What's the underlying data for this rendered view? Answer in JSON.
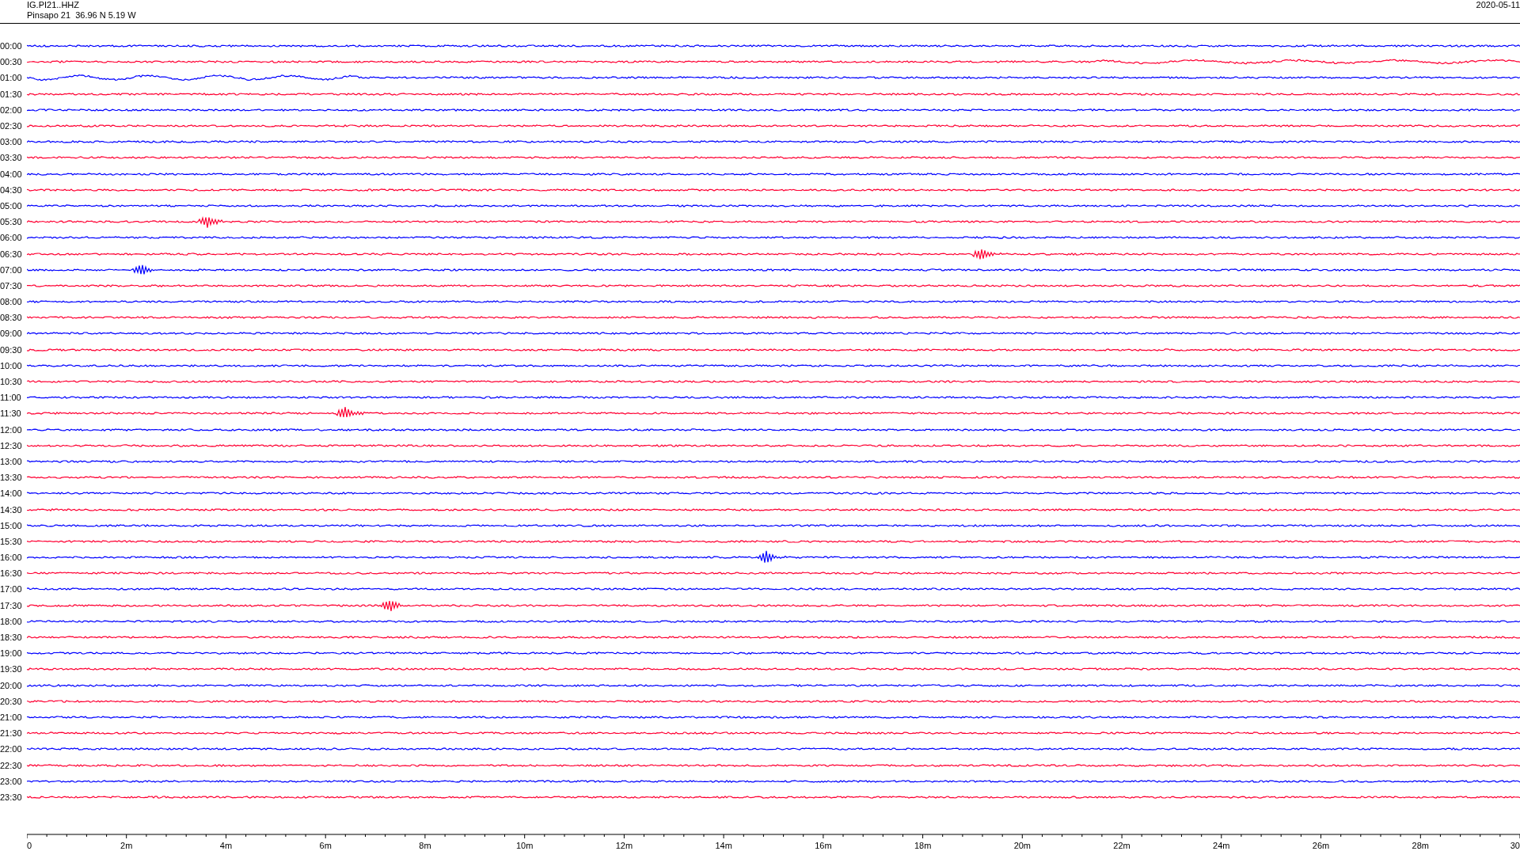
{
  "header": {
    "station": "IG.PI21..HHZ",
    "location": "Pinsapo 21  36.96 N 5.19 W",
    "date": "2020-05-11"
  },
  "rows": [
    {
      "label": "00:00",
      "color": "#0000ff",
      "kind": "quiet"
    },
    {
      "label": "00:30",
      "color": "#ff0033",
      "kind": "swell_late"
    },
    {
      "label": "01:00",
      "color": "#0000ff",
      "kind": "swell_early"
    },
    {
      "label": "01:30",
      "color": "#ff0033",
      "kind": "quiet"
    },
    {
      "label": "02:00",
      "color": "#0000ff",
      "kind": "quiet"
    },
    {
      "label": "02:30",
      "color": "#ff0033",
      "kind": "quiet"
    },
    {
      "label": "03:00",
      "color": "#0000ff",
      "kind": "quiet"
    },
    {
      "label": "03:30",
      "color": "#ff0033",
      "kind": "quiet"
    },
    {
      "label": "04:00",
      "color": "#0000ff",
      "kind": "quiet"
    },
    {
      "label": "04:30",
      "color": "#ff0033",
      "kind": "quiet"
    },
    {
      "label": "05:00",
      "color": "#0000ff",
      "kind": "quiet"
    },
    {
      "label": "05:30",
      "color": "#ff0033",
      "kind": "event"
    },
    {
      "label": "06:00",
      "color": "#0000ff",
      "kind": "quiet"
    },
    {
      "label": "06:30",
      "color": "#ff0033",
      "kind": "event"
    },
    {
      "label": "07:00",
      "color": "#0000ff",
      "kind": "event"
    },
    {
      "label": "07:30",
      "color": "#ff0033",
      "kind": "quiet"
    },
    {
      "label": "08:00",
      "color": "#0000ff",
      "kind": "quiet"
    },
    {
      "label": "08:30",
      "color": "#ff0033",
      "kind": "quiet"
    },
    {
      "label": "09:00",
      "color": "#0000ff",
      "kind": "quiet"
    },
    {
      "label": "09:30",
      "color": "#ff0033",
      "kind": "quiet"
    },
    {
      "label": "10:00",
      "color": "#0000ff",
      "kind": "quiet"
    },
    {
      "label": "10:30",
      "color": "#ff0033",
      "kind": "quiet"
    },
    {
      "label": "11:00",
      "color": "#0000ff",
      "kind": "quiet"
    },
    {
      "label": "11:30",
      "color": "#ff0033",
      "kind": "event"
    },
    {
      "label": "12:00",
      "color": "#0000ff",
      "kind": "quiet"
    },
    {
      "label": "12:30",
      "color": "#ff0033",
      "kind": "quiet"
    },
    {
      "label": "13:00",
      "color": "#0000ff",
      "kind": "quiet"
    },
    {
      "label": "13:30",
      "color": "#ff0033",
      "kind": "quiet"
    },
    {
      "label": "14:00",
      "color": "#0000ff",
      "kind": "quiet"
    },
    {
      "label": "14:30",
      "color": "#ff0033",
      "kind": "quiet"
    },
    {
      "label": "15:00",
      "color": "#0000ff",
      "kind": "quiet"
    },
    {
      "label": "15:30",
      "color": "#ff0033",
      "kind": "quiet"
    },
    {
      "label": "16:00",
      "color": "#0000ff",
      "kind": "event"
    },
    {
      "label": "16:30",
      "color": "#ff0033",
      "kind": "quiet"
    },
    {
      "label": "17:00",
      "color": "#0000ff",
      "kind": "quiet"
    },
    {
      "label": "17:30",
      "color": "#ff0033",
      "kind": "event"
    },
    {
      "label": "18:00",
      "color": "#0000ff",
      "kind": "quiet"
    },
    {
      "label": "18:30",
      "color": "#ff0033",
      "kind": "quiet"
    },
    {
      "label": "19:00",
      "color": "#0000ff",
      "kind": "quiet"
    },
    {
      "label": "19:30",
      "color": "#ff0033",
      "kind": "quiet"
    },
    {
      "label": "20:00",
      "color": "#0000ff",
      "kind": "quiet"
    },
    {
      "label": "20:30",
      "color": "#ff0033",
      "kind": "quiet"
    },
    {
      "label": "21:00",
      "color": "#0000ff",
      "kind": "quiet"
    },
    {
      "label": "21:30",
      "color": "#ff0033",
      "kind": "quiet"
    },
    {
      "label": "22:00",
      "color": "#0000ff",
      "kind": "quiet"
    },
    {
      "label": "22:30",
      "color": "#ff0033",
      "kind": "quiet"
    },
    {
      "label": "23:00",
      "color": "#0000ff",
      "kind": "quiet"
    },
    {
      "label": "23:30",
      "color": "#ff0033",
      "kind": "quiet"
    }
  ],
  "time_axis": {
    "ticks": [
      "0",
      "2m",
      "4m",
      "6m",
      "8m",
      "10m",
      "12m",
      "14m",
      "16m",
      "18m",
      "20m",
      "22m",
      "24m",
      "26m",
      "28m",
      "30"
    ]
  }
}
